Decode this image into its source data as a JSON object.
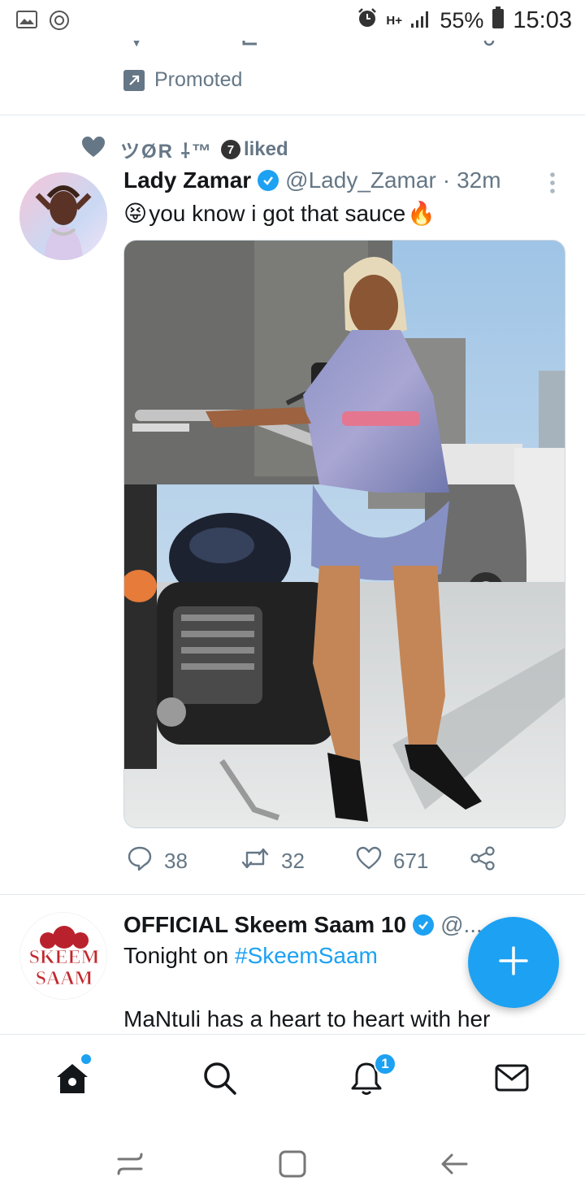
{
  "status_bar": {
    "network": "H+",
    "battery": "55%",
    "time": "15:03"
  },
  "promoted_tweet": {
    "promoted_label": "Promoted"
  },
  "social_context": {
    "liker_name": "ツØR ⸸™",
    "badge": "7",
    "action": "liked"
  },
  "tweet1": {
    "display_name": "Lady Zamar",
    "handle": "@Lady_Zamar",
    "separator": "·",
    "time": "32m",
    "text": "you know i got that sauce",
    "emoji_start": "😝",
    "emoji_end": "🔥",
    "replies": "38",
    "retweets": "32",
    "likes": "671"
  },
  "tweet2": {
    "display_name": "OFFICIAL Skeem Saam 10",
    "handle": "@...",
    "text_prefix": "Tonight on ",
    "hashtag": "#SkeemSaam",
    "text_line2": "MaNtuli has a heart to heart with her",
    "avatar_text_line1": "SKEEM",
    "avatar_text_line2": "SAAM"
  },
  "bottom_nav": {
    "notification_count": "1"
  },
  "colors": {
    "accent": "#1da1f2",
    "secondary_text": "#657786",
    "primary_text": "#14171a"
  }
}
